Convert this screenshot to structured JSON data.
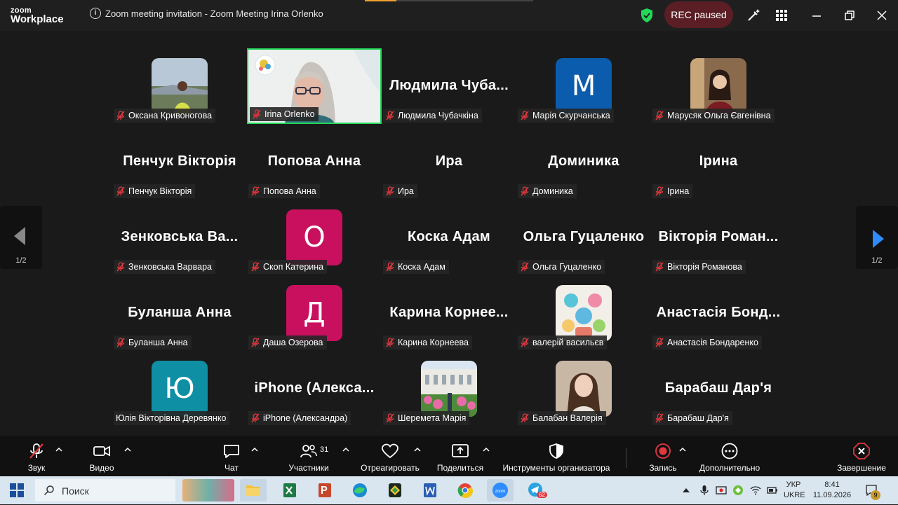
{
  "app": {
    "logo_top": "zoom",
    "logo_bottom": "Workplace",
    "title": "Zoom meeting invitation - Zoom Meeting Irina Orlenko",
    "rec_status": "REC paused"
  },
  "colors": {
    "accent_green": "#23d959",
    "rec_bg": "#5a1e24",
    "muted_red": "#e0383e",
    "nav_arrow": "#2d8cff"
  },
  "pagination": {
    "left": "1/2",
    "right": "1/2"
  },
  "tiles": [
    {
      "kind": "photo",
      "label": "Оксана Кривоногова",
      "photo": "landscape-person"
    },
    {
      "kind": "video",
      "label": "Irina Orlenko",
      "active": true
    },
    {
      "kind": "name",
      "bigname": "Людмила  Чуба...",
      "label": "Людмила Чубачкіна"
    },
    {
      "kind": "letter",
      "letter": "M",
      "bg": "#0b5cad",
      "label": "Марія Скурчанська"
    },
    {
      "kind": "photo",
      "label": "Марусяк Ольга Євгенівна",
      "photo": "woman-portrait"
    },
    {
      "kind": "name",
      "bigname": "Пенчук Вікторія",
      "label": "Пенчук Вікторія"
    },
    {
      "kind": "name",
      "bigname": "Попова Анна",
      "label": "Попова Анна"
    },
    {
      "kind": "name",
      "bigname": "Ира",
      "label": "Ира"
    },
    {
      "kind": "name",
      "bigname": "Доминика",
      "label": "Доминика"
    },
    {
      "kind": "name",
      "bigname": "Ірина",
      "label": "Ірина"
    },
    {
      "kind": "name",
      "bigname": "Зенковська  Ва...",
      "label": "Зенковська Варвара"
    },
    {
      "kind": "letter",
      "letter": "О",
      "bg": "#c8105f",
      "label": "Скоп Катерина"
    },
    {
      "kind": "name",
      "bigname": "Коска Адам",
      "label": "Коска Адам"
    },
    {
      "kind": "name",
      "bigname": "Ольга Гуцаленко",
      "label": "Ольга Гуцаленко"
    },
    {
      "kind": "name",
      "bigname": "Вікторія  Роман...",
      "label": "Вікторія Романова"
    },
    {
      "kind": "name",
      "bigname": "Буланша Анна",
      "label": "Буланша Анна"
    },
    {
      "kind": "letter",
      "letter": "Д",
      "bg": "#c8105f",
      "label": "Даша Озерова"
    },
    {
      "kind": "name",
      "bigname": "Карина  Корнее...",
      "label": "Карина Корнеева"
    },
    {
      "kind": "photo",
      "label": "валерій васильєв",
      "photo": "cartoon-group"
    },
    {
      "kind": "name",
      "bigname": "Анастасія  Бонд...",
      "label": "Анастасія Бондаренко"
    },
    {
      "kind": "letter",
      "letter": "Ю",
      "bg": "#0e8fa3",
      "label": "Юлія Вікторівна Деревянко",
      "nomute": true
    },
    {
      "kind": "name",
      "bigname": "iPhone  (Алекса...",
      "label": "iPhone (Александра)"
    },
    {
      "kind": "photo",
      "label": "Шеремета Марія",
      "photo": "building-flowers"
    },
    {
      "kind": "photo",
      "label": "Балабан Валерія",
      "photo": "girl-portrait"
    },
    {
      "kind": "name",
      "bigname": "Барабаш Дар'я",
      "label": "Барабаш Дар'я"
    }
  ],
  "toolbar": {
    "audio": "Звук",
    "video": "Видео",
    "chat": "Чат",
    "participants": "Участники",
    "participants_count": "31",
    "react": "Отреагировать",
    "share": "Поделиться",
    "host_tools": "Инструменты организатора",
    "record": "Запись",
    "more": "Дополнительно",
    "end": "Завершение"
  },
  "taskbar": {
    "search_placeholder": "Поиск",
    "lang_line1": "УКР",
    "lang_line2": "UKRE",
    "time": "8:41",
    "date": "11.09.2026",
    "notif_count": "9",
    "telegram_badge": "62"
  }
}
